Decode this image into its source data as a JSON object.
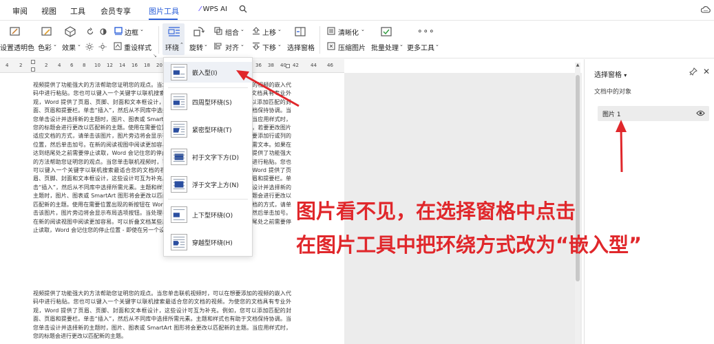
{
  "menu": {
    "items": [
      "审阅",
      "视图",
      "工具",
      "会员专享",
      "图片工具"
    ],
    "active": "图片工具",
    "wps_ai": "WPS AI"
  },
  "ribbon": {
    "set_transparent": "设置透明色",
    "color": "色彩",
    "effect": "效果",
    "border": "边框",
    "reset_style": "重设样式",
    "wrap": "环绕",
    "rotate": "旋转",
    "group": "组合",
    "align": "对齐",
    "bring_forward": "上移",
    "send_backward": "下移",
    "selection_pane": "选择窗格",
    "sharpen": "清晰化",
    "compress": "压缩图片",
    "batch": "批量处理",
    "more_tools": "更多工具"
  },
  "ruler": [
    "4",
    "2",
    "2",
    "4",
    "6",
    "8",
    "10",
    "12",
    "14",
    "16",
    "18",
    "20",
    "22",
    "24",
    "26",
    "28",
    "30",
    "32",
    "34",
    "36",
    "38",
    "40",
    "42",
    "44",
    "46"
  ],
  "wrap_menu": {
    "items": [
      "嵌入型(I)",
      "四周型环绕(S)",
      "紧密型环绕(T)",
      "衬于文字下方(D)",
      "浮于文字上方(N)",
      "上下型环绕(O)",
      "穿越型环绕(H)"
    ]
  },
  "document": {
    "para1": "视频提供了功能强大的方法帮助您证明您的观点。当您单击联机视频时，可以在想要添加的视频的嵌入代码中进行粘贴。您也可以键入一个关键字以联机搜索最适合您的文档的视频。为使您的文档具有专业外观，Word 提供了页眉、页脚、封面和文本框设计，这些设计可互为补充。例如，您可以添加匹配的封面、页眉和提要栏。单击“插入”，然后从不同库中选择所需元素。主题和样式也有助于文档保持协调。当您单击设计并选择新的主题时，图片、图表或 SmartArt 图形将会更改以匹配新的主题。当应用样式时，您的标题会进行更改以匹配新的主题。使用在需要位置出现的新按钮在 Word 中保存时间。若要更改图片适应文档的方式，请单击该图片，图片旁边将会显示布局选项按钮。当处理表格时，单击要添加行或列的位置，然后单击加号。在新的阅读视图中阅读更加容易。可以折叠文档某些部分并关注所需文本。如果在达到结尾处之前需要停止读取，Word 会记住您的停止位置 - 即使在另一个设备上。视频提供了功能强大的方法帮助您证明您的观点。当您单击联机视频时，可以在想要添加的视频的嵌入代码中进行粘贴。您也可以键入一个关键字以联机搜索最适合您的文档的视频。为使您的文档具有专业外观，Word 提供了页眉、页脚、封面和文本框设计，这些设计可互为补充。例如，您可以添加匹配的封面、页眉和提要栏。单击“插入”，然后从不同库中选择所需元素。主题和样式也有助于文档保持协调。当您单击设计并选择新的主题时，图片、图表或 SmartArt 图形将会更改以匹配新的主题。当应用样式时，您的标题会进行更改以匹配新的主题。使用在需要位置出现的新按钮在 Word 中保存时间。若要更改图片适应文档的方式，请单击该图片，图片旁边将会显示布局选项按钮。当处理表格时，单击要添加行或列的位置，然后单击加号。在新的阅读视图中阅读更加容易。可以折叠文档某些部分并关注所需文本。如果在达到结尾处之前需要停止读取，Word 会记住您的停止位置 - 即使在另一个设备上。",
    "para2": "视频提供了功能强大的方法帮助您证明您的观点。当您单击联机视频时，可以在想要添加的视频的嵌入代码中进行粘贴。您也可以键入一个关键字以联机搜索最适合您的文档的视频。为使您的文档具有专业外观，Word 提供了页眉、页脚、封面和文本框设计，这些设计可互为补充。例如，您可以添加匹配的封面、页眉和提要栏。单击“插入”，然后从不同库中选择所需元素。主题和样式也有助于文档保持协调。当您单击设计并选择新的主题时，图片、图表或 SmartArt 图形将会更改以匹配新的主题。当应用样式时，您的标题会进行更改以匹配新的主题。"
  },
  "pane": {
    "title": "选择窗格",
    "subtitle": "文档中的对象",
    "object": "图片 1"
  },
  "annotation": {
    "line1": "图片看不见，在选择窗格中点击",
    "line2": "在图片工具中把环绕方式改为“嵌入型”"
  },
  "colors": {
    "accent": "#2b5fd9",
    "annotation": "#e0272b",
    "pane_item_bg": "#ececec"
  }
}
